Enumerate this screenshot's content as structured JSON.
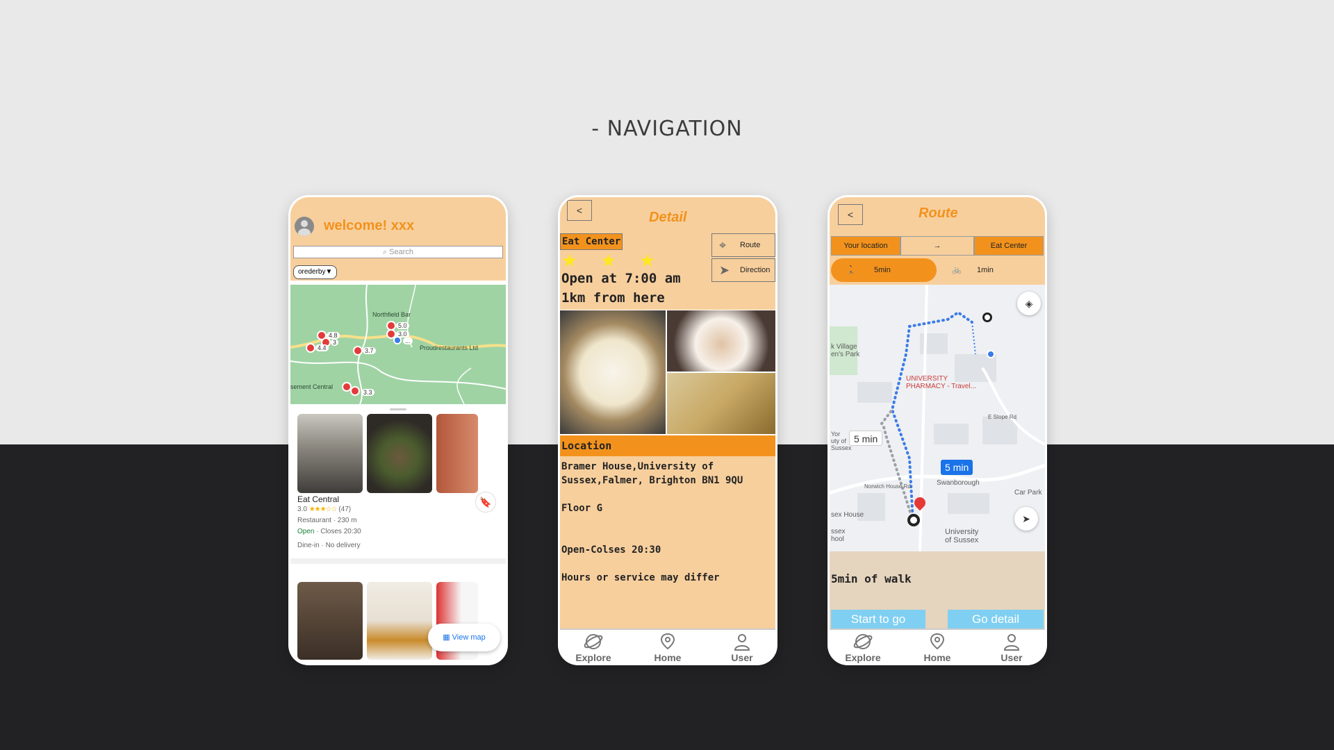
{
  "page": {
    "title": "- NAVIGATION"
  },
  "explore": {
    "welcome": "welcome! xxx",
    "search_placeholder": "Search",
    "orderby": "orederby▼",
    "map_labels": {
      "northfield": "Northfield Bar",
      "proud": "Proudrestaurants Ltd",
      "sement": "sement Central"
    },
    "map_ratings": [
      "4.8",
      "5.0",
      "3.0",
      "4.4",
      "3",
      "3.7",
      "3.3",
      "..."
    ],
    "place": {
      "name": "Eat Central",
      "rating": "3.0",
      "stars": "★★★☆☆",
      "reviews": "(47)",
      "type": "Restaurant · 230 m",
      "open": "Open",
      "closes": " · Closes 20:30",
      "service": "Dine-in · No delivery"
    },
    "view_map": "View map"
  },
  "detail": {
    "back": "<",
    "title": "Detail",
    "tag": "Eat Center",
    "stars": [
      "★",
      "★",
      "★"
    ],
    "route": "Route",
    "direction": "Direction",
    "open_line": "Open at 7:00 am",
    "distance": "1km from here",
    "location_header": "Location",
    "address": "Bramer House,University of Sussex,Falmer, Brighton BN1 9QU",
    "floor": "Floor G",
    "hours": "Open-Colses 20:30",
    "note": "Hours or service may differ"
  },
  "route": {
    "back": "<",
    "title": "Route",
    "from": "Your location",
    "arrow": "→",
    "to": "Eat Center",
    "walk_time": "5min",
    "bike_time": "1min",
    "map_labels": {
      "village": "k Village\nen's Park",
      "pharmacy": "UNIVERSITY\nPHARMACY - Travel...",
      "stope": "E Stope Rd",
      "york": "Yor\nuty of\nSussex",
      "norwich": "Norwich House Rd",
      "swan": "Swanborough",
      "carpark": "Car Park",
      "sex_house": "sex House",
      "ssex": "ssex\nhool",
      "uni": "University\nof Sussex"
    },
    "chip_grey": "5 min",
    "chip_blue": "5 min",
    "walk_text": "5min of walk",
    "start": "Start to go",
    "go_detail": "Go detail"
  },
  "tabbar": {
    "explore": "Explore",
    "home": "Home",
    "user": "User"
  },
  "colors": {
    "orange": "#f2921d",
    "peach": "#f7cf9d",
    "blue": "#1a73e8",
    "sky": "#7fcff2"
  }
}
